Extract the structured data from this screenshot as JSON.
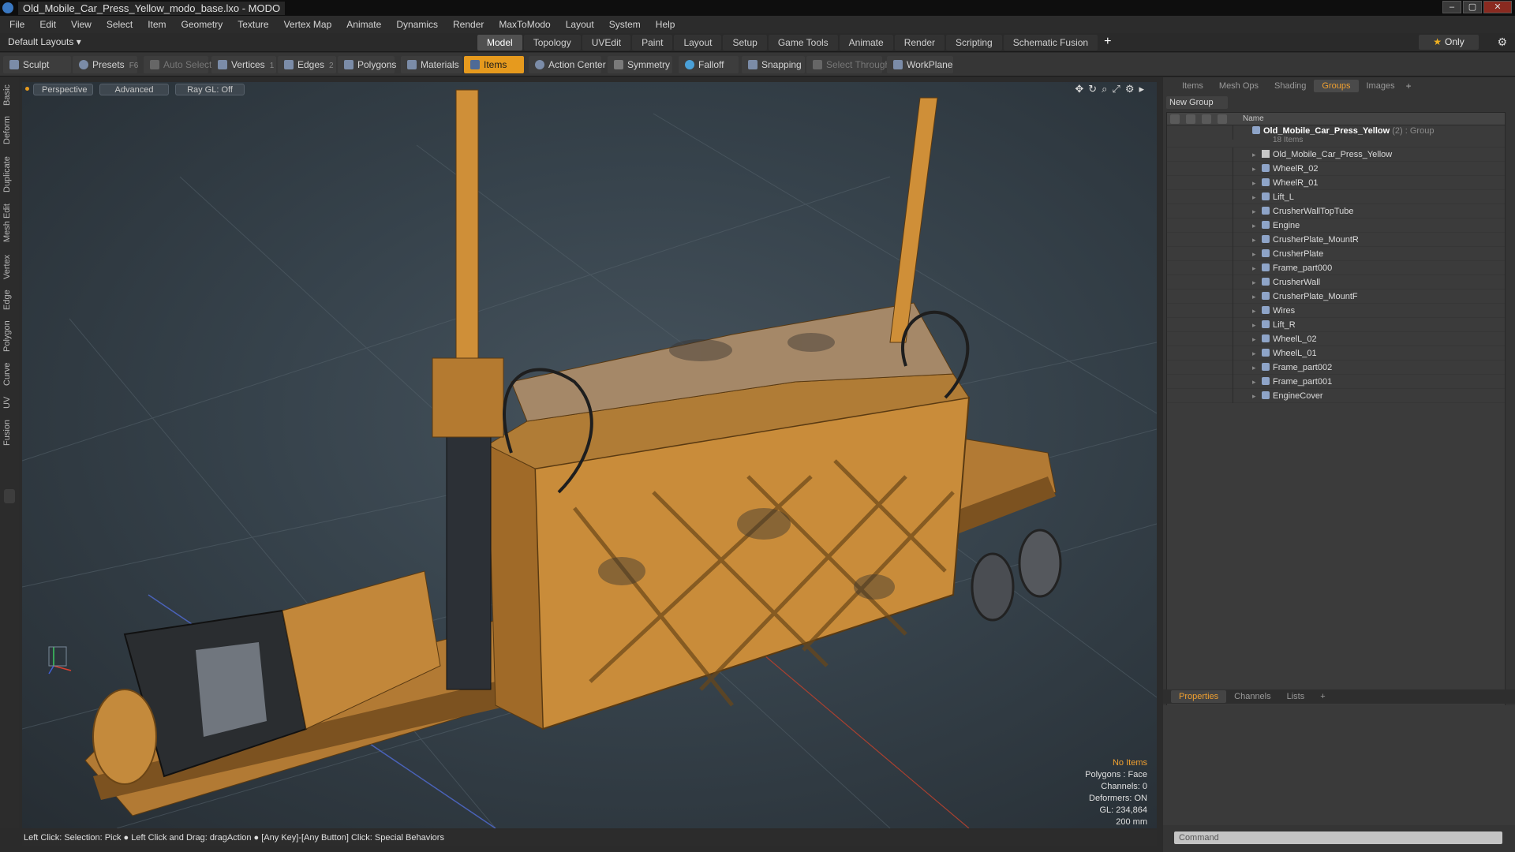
{
  "window": {
    "title": "Old_Mobile_Car_Press_Yellow_modo_base.lxo - MODO"
  },
  "menu": [
    "File",
    "Edit",
    "View",
    "Select",
    "Item",
    "Geometry",
    "Texture",
    "Vertex Map",
    "Animate",
    "Dynamics",
    "Render",
    "MaxToModo",
    "Layout",
    "System",
    "Help"
  ],
  "layouts": {
    "current": "Default Layouts ▾",
    "tabs": [
      "Model",
      "Topology",
      "UVEdit",
      "Paint",
      "Layout",
      "Setup",
      "Game Tools",
      "Animate",
      "Render",
      "Scripting",
      "Schematic Fusion"
    ],
    "active": "Model",
    "only_label": "Only"
  },
  "toolbar": {
    "sculpt": "Sculpt",
    "presets": "Presets",
    "presets_key": "F6",
    "auto_select": "Auto Select",
    "vertices": "Vertices",
    "vertices_count": "1",
    "edges": "Edges",
    "edges_count": "2",
    "polygons": "Polygons",
    "materials": "Materials",
    "items": "Items",
    "action_center": "Action Center",
    "symmetry": "Symmetry",
    "falloff": "Falloff",
    "snapping": "Snapping",
    "select_through": "Select Through",
    "workplane": "WorkPlane"
  },
  "left_tabs": [
    "Basic",
    "Deform",
    "Duplicate",
    "Mesh Edit",
    "Vertex",
    "Edge",
    "Polygon",
    "Curve",
    "UV",
    "Fusion"
  ],
  "viewport": {
    "view": "Perspective",
    "shading": "Advanced",
    "raygl": "Ray GL: Off",
    "info": {
      "selection": "No Items",
      "polygons": "Polygons : Face",
      "channels": "Channels: 0",
      "deformers": "Deformers: ON",
      "gl": "GL: 234,864",
      "scale": "200 mm"
    }
  },
  "right_panel": {
    "tabs": [
      "Items",
      "Mesh Ops",
      "Shading",
      "Groups",
      "Images"
    ],
    "active": "Groups",
    "new_group": "New Group",
    "name_header": "Name",
    "root": {
      "name": "Old_Mobile_Car_Press_Yellow",
      "meta": "(2) : Group",
      "count": "18 Items"
    },
    "items": [
      "Old_Mobile_Car_Press_Yellow",
      "WheelR_02",
      "WheelR_01",
      "Lift_L",
      "CrusherWallTopTube",
      "Engine",
      "CrusherPlate_MountR",
      "CrusherPlate",
      "Frame_part000",
      "CrusherWall",
      "CrusherPlate_MountF",
      "Wires",
      "Lift_R",
      "WheelL_02",
      "WheelL_01",
      "Frame_part002",
      "Frame_part001",
      "EngineCover"
    ],
    "bottom_tabs": [
      "Properties",
      "Channels",
      "Lists"
    ],
    "bottom_active": "Properties",
    "command_placeholder": "Command"
  },
  "status": "Left Click: Selection: Pick ● Left Click and Drag: dragAction ● [Any Key]-[Any Button] Click: Special Behaviors",
  "colors": {
    "accent": "#e69a1e",
    "model": "#d9962e"
  }
}
